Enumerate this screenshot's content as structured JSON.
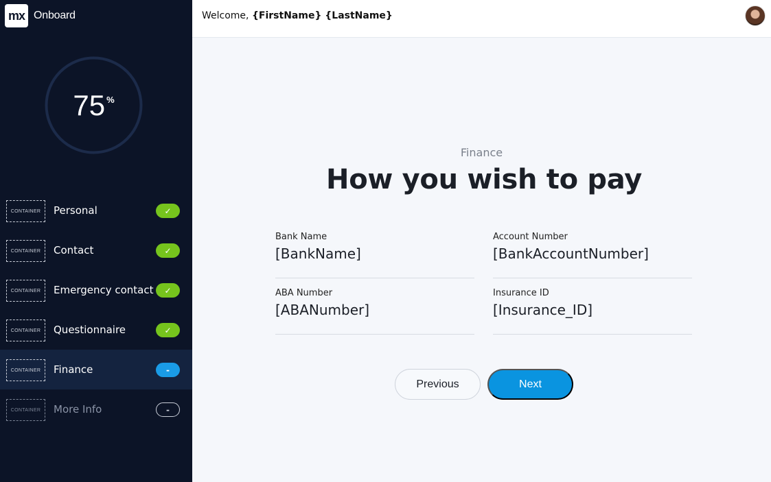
{
  "app": {
    "logo_text": "mx",
    "name": "Onboard"
  },
  "progress": {
    "value": "75",
    "unit": "%",
    "fraction": 0.75
  },
  "steps": [
    {
      "container_label": "CONTAINER",
      "label": "Personal",
      "status": "done",
      "status_glyph": "✓"
    },
    {
      "container_label": "CONTAINER",
      "label": "Contact",
      "status": "done",
      "status_glyph": "✓"
    },
    {
      "container_label": "CONTAINER",
      "label": "Emergency contact",
      "status": "done",
      "status_glyph": "✓"
    },
    {
      "container_label": "CONTAINER",
      "label": "Questionnaire",
      "status": "done",
      "status_glyph": "✓"
    },
    {
      "container_label": "CONTAINER",
      "label": "Finance",
      "status": "current",
      "status_glyph": "-"
    },
    {
      "container_label": "CONTAINER",
      "label": "More Info",
      "status": "todo",
      "status_glyph": "-"
    }
  ],
  "header": {
    "welcome_prefix": "Welcome,",
    "user_name": "{FirstName} {LastName}"
  },
  "main": {
    "section": "Finance",
    "title": "How you wish to pay",
    "fields": [
      {
        "label": "Bank Name",
        "value": "[BankName]"
      },
      {
        "label": "Account Number",
        "value": "[BankAccountNumber]"
      },
      {
        "label": "ABA Number",
        "value": "[ABANumber]"
      },
      {
        "label": "Insurance  ID",
        "value": "[Insurance_ID]"
      }
    ],
    "previous_label": "Previous",
    "next_label": "Next"
  },
  "colors": {
    "sidebar_bg": "#0c1427",
    "done": "#76c41d",
    "current": "#1a9be6",
    "primary": "#0a94e0"
  },
  "icons": {
    "done": "check-icon",
    "avatar": "user-avatar"
  }
}
